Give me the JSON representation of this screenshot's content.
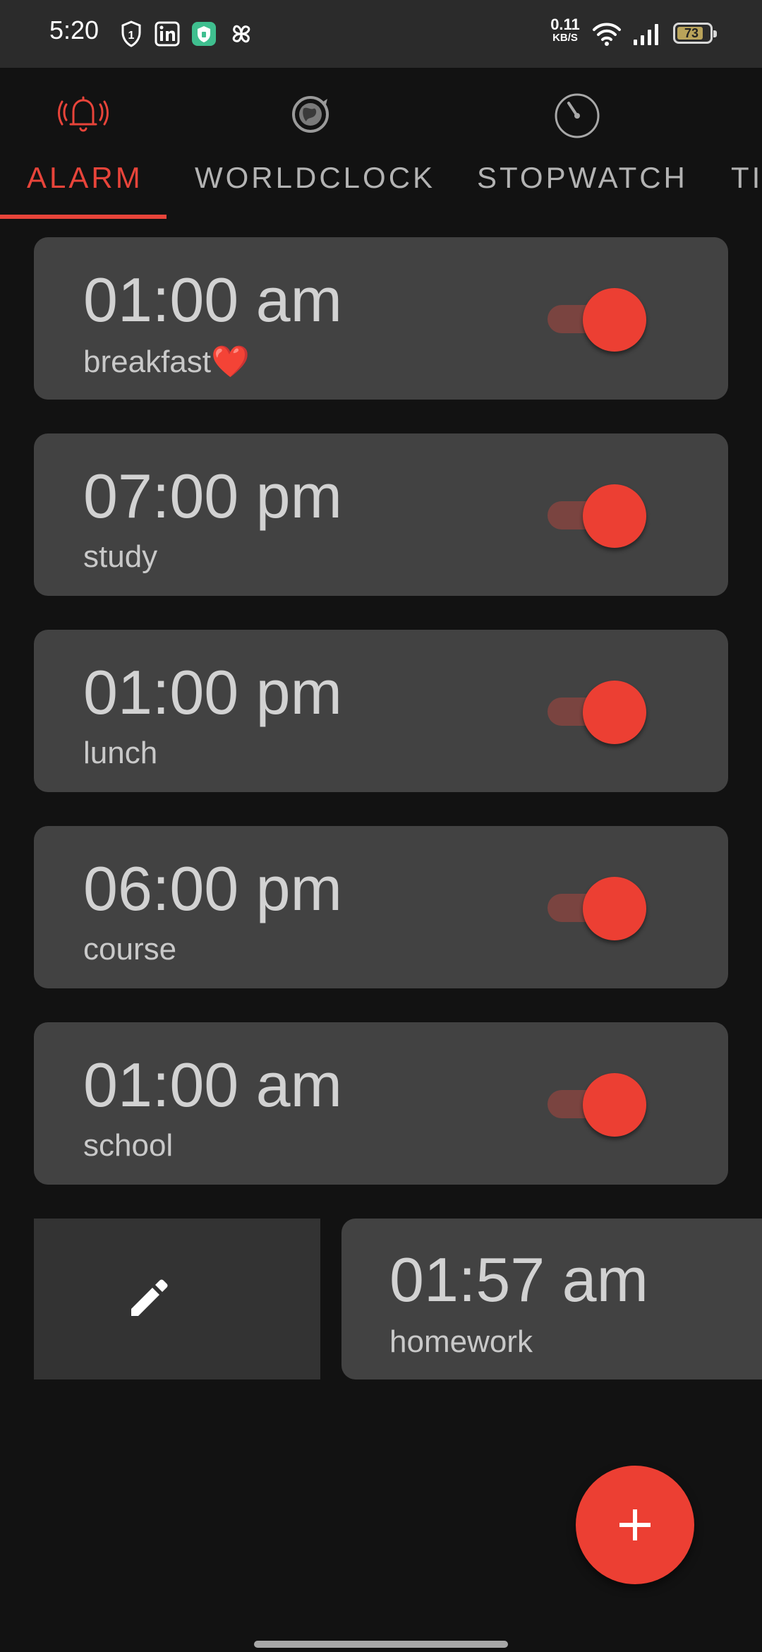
{
  "status_bar": {
    "time": "5:20",
    "net_speed_value": "0.11",
    "net_speed_unit": "KB/S",
    "battery": "73"
  },
  "tabs": [
    {
      "label": "ALARM",
      "icon": "alarm-bell-icon",
      "active": true
    },
    {
      "label": "WORLDCLOCK",
      "icon": "globe-icon",
      "active": false
    },
    {
      "label": "STOPWATCH",
      "icon": "stopwatch-icon",
      "active": false
    },
    {
      "label": "TI",
      "icon": "timer-icon",
      "active": false
    }
  ],
  "alarms": [
    {
      "time": "01:00 am",
      "label": "breakfast❤️",
      "enabled": true
    },
    {
      "time": "07:00 pm",
      "label": "study",
      "enabled": true
    },
    {
      "time": "01:00 pm",
      "label": "lunch",
      "enabled": true
    },
    {
      "time": "06:00 pm",
      "label": "course",
      "enabled": true
    },
    {
      "time": "01:00 am",
      "label": "school",
      "enabled": true
    }
  ],
  "swiped_alarm": {
    "time": "01:57 am",
    "label": "homework"
  },
  "colors": {
    "accent": "#ec3f33",
    "card": "#424242",
    "background": "#121212"
  }
}
